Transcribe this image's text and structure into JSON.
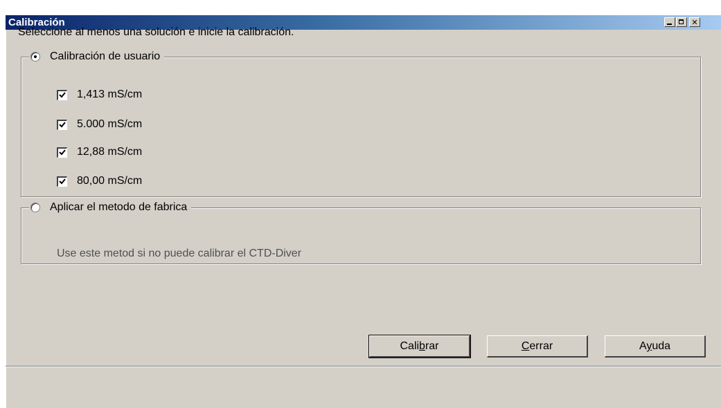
{
  "window": {
    "title": "Calibración",
    "controls": {
      "minimize": "minimize",
      "maximize": "maximize",
      "close": "✕"
    }
  },
  "instruction": "Seleccione al menos una solución e inicie la calibración.",
  "user_calibration": {
    "label": "Calibración de usuario",
    "selected": true,
    "solutions": [
      {
        "label": "1,413 mS/cm",
        "checked": true
      },
      {
        "label": "5.000 mS/cm",
        "checked": true
      },
      {
        "label": "12,88 mS/cm",
        "checked": true
      },
      {
        "label": "80,00 mS/cm",
        "checked": true
      }
    ]
  },
  "factory_method": {
    "label": "Aplicar el metodo de fabrica",
    "selected": false,
    "description": "Use este metod si no puede calibrar el CTD-Diver"
  },
  "buttons": {
    "calibrar": {
      "before": "Cali",
      "mnemonic": "b",
      "after": "rar"
    },
    "cerrar": {
      "before": "",
      "mnemonic": "C",
      "after": "errar"
    },
    "ayuda": {
      "before": "A",
      "mnemonic": "y",
      "after": "uda"
    }
  },
  "colors": {
    "title_gradient_start": "#0a246a",
    "title_gradient_end": "#a6caf0",
    "dialog_face": "#d4d0c8"
  }
}
